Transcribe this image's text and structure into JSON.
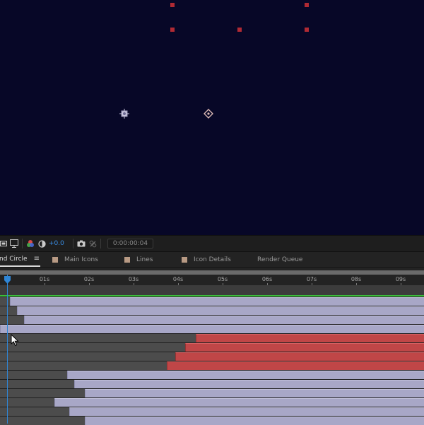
{
  "viewer": {
    "background_color": "#070727",
    "handle_color": "#b02a34"
  },
  "viewer_toolbar": {
    "icons": [
      "region-of-interest-icon",
      "toggle-transparency-grid-icon",
      "channels-icon",
      "reset-exposure-icon",
      "snapshot-icon",
      "show-snapshot-icon"
    ],
    "exposure_value": "+0.0",
    "timecode": "0:00:00:04"
  },
  "tabs": [
    {
      "label": "nd Circle",
      "active": true
    },
    {
      "label": "Main Icons",
      "active": false,
      "swatch": "#b89a84"
    },
    {
      "label": "Lines",
      "active": false,
      "swatch": "#b89a84"
    },
    {
      "label": "Icon Details",
      "active": false,
      "swatch": "#b89a84"
    },
    {
      "label": "Render Queue",
      "active": false
    }
  ],
  "timeline": {
    "ruler_labels": [
      "01s",
      "02s",
      "03s",
      "04s",
      "05s",
      "06s",
      "07s",
      "08s",
      "09s"
    ],
    "current_time_indicator_color": "#2f86d6",
    "label_colors": {
      "lavender": "#a8a7c7",
      "red": "#c04647",
      "work_area_green": "#3bbd3b"
    },
    "layers": [
      {
        "color": "lavender",
        "start_s": 0.22
      },
      {
        "color": "lavender",
        "start_s": 0.38
      },
      {
        "color": "lavender",
        "start_s": 0.54
      },
      {
        "color": "lavender",
        "start_s": 0.0
      },
      {
        "color": "red",
        "start_s": 4.4
      },
      {
        "color": "red",
        "start_s": 4.16
      },
      {
        "color": "red",
        "start_s": 3.93
      },
      {
        "color": "red",
        "start_s": 3.74
      },
      {
        "color": "lavender",
        "start_s": 1.5
      },
      {
        "color": "lavender",
        "start_s": 1.67
      },
      {
        "color": "lavender",
        "start_s": 1.91
      },
      {
        "color": "lavender",
        "start_s": 1.22
      },
      {
        "color": "lavender",
        "start_s": 1.56
      },
      {
        "color": "lavender",
        "start_s": 1.91
      }
    ]
  }
}
